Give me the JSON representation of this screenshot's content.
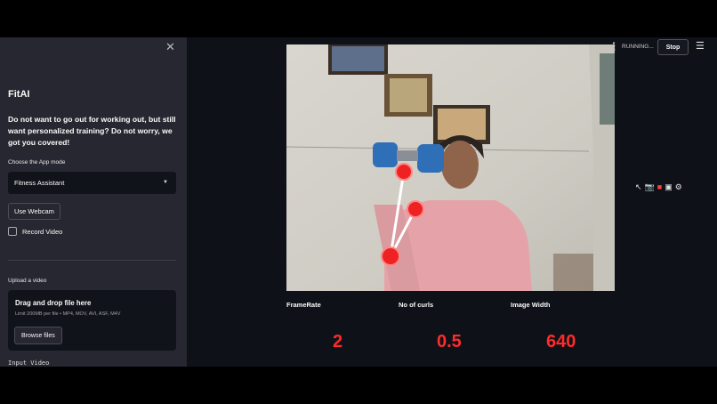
{
  "sidebar": {
    "close_icon": "close-icon",
    "brand": "FitAI",
    "intro": "Do not want to go out for working out, but still want personalized training? Do not worry, we got you covered!",
    "mode_label": "Choose the App mode",
    "mode_selected": "Fitness Assistant",
    "webcam_button": "Use Webcam",
    "record_checkbox": "Record Video",
    "upload_label": "Upload a video",
    "drop_title": "Drag and drop file here",
    "drop_limit": "Limit 200MB per file • MP4, MOV, AVI, ASF, M4V",
    "browse_button": "Browse files",
    "input_video_label": "Input Video"
  },
  "topbar": {
    "status": "RUNNING...",
    "stop_button": "Stop",
    "menu_icon": "hamburger-menu-icon"
  },
  "stats": [
    {
      "label": "FrameRate",
      "value": "2"
    },
    {
      "label": "No of curls",
      "value": "0.5"
    },
    {
      "label": "Image Width",
      "value": "640"
    }
  ],
  "colors": {
    "sidebar_bg": "#262730",
    "main_bg": "#0e1117",
    "accent_red": "#ff2b2b"
  }
}
